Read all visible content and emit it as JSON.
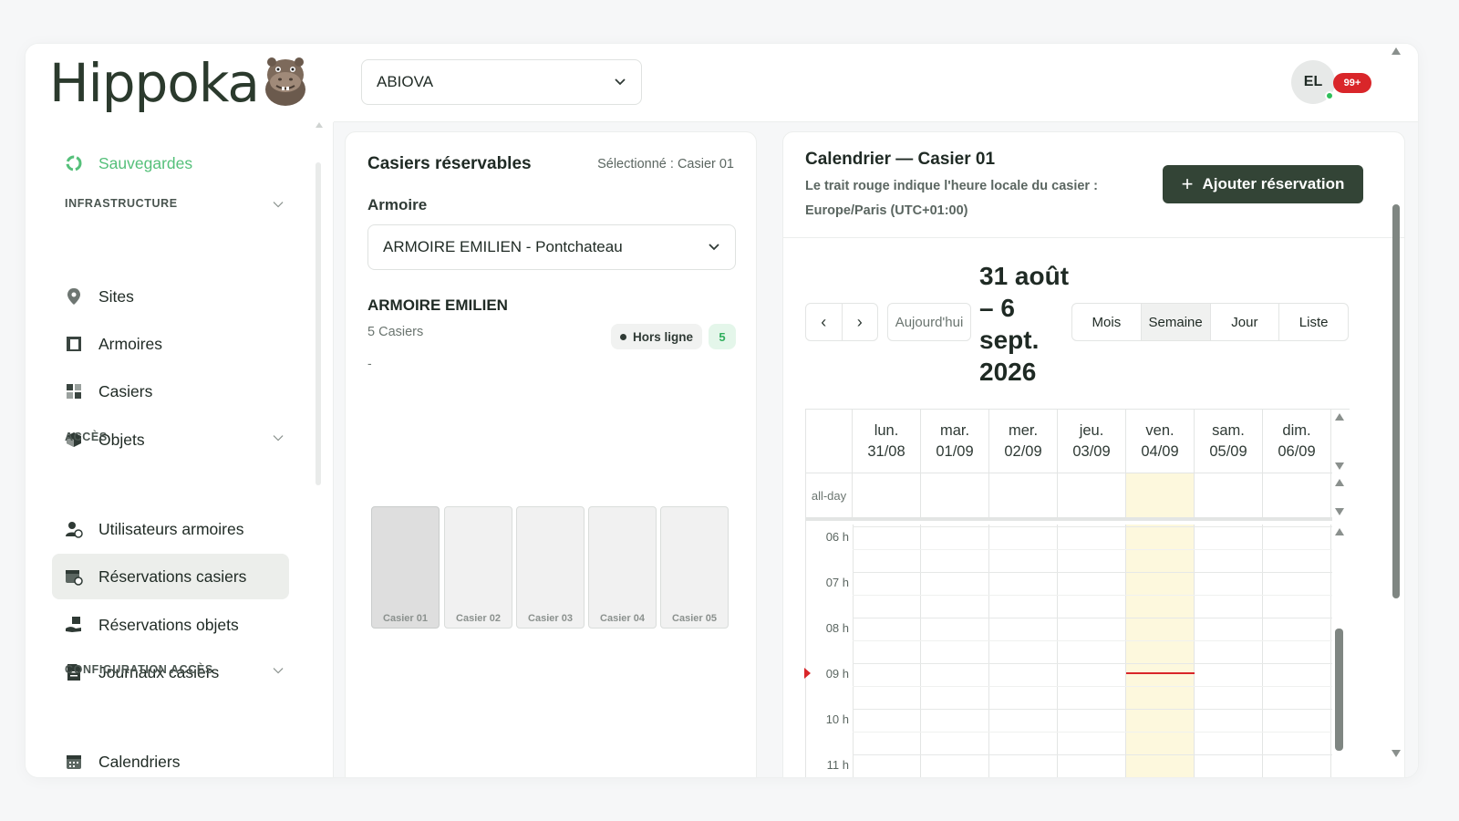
{
  "brand": {
    "name": "Hippoka"
  },
  "header": {
    "org_select_value": "ABIOVA",
    "user_initials": "EL",
    "notification_count": "99+"
  },
  "sidebar": {
    "top_item": {
      "label": "Sauvegardes",
      "icon": "backup-icon"
    },
    "groups": [
      {
        "title": "INFRASTRUCTURE",
        "items": [
          {
            "label": "Sites",
            "icon": "location-pin-icon"
          },
          {
            "label": "Armoires",
            "icon": "cabinet-icon"
          },
          {
            "label": "Casiers",
            "icon": "grid-icon"
          },
          {
            "label": "Objets",
            "icon": "cube-icon"
          }
        ]
      },
      {
        "title": "ACCÈS",
        "items": [
          {
            "label": "Utilisateurs armoires",
            "icon": "user-check-icon"
          },
          {
            "label": "Réservations casiers",
            "icon": "calendar-check-icon",
            "active": true
          },
          {
            "label": "Réservations objets",
            "icon": "hand-box-icon"
          },
          {
            "label": "Journaux casiers",
            "icon": "journal-icon"
          }
        ]
      },
      {
        "title": "CONFIGURATION ACCÈS",
        "items": [
          {
            "label": "Calendriers",
            "icon": "calendar-icon"
          }
        ]
      }
    ]
  },
  "lockers_panel": {
    "title": "Casiers réservables",
    "selected_text": "Sélectionné : Casier 01",
    "cabinet_label": "Armoire",
    "cabinet_select_value": "ARMOIRE EMILIEN - Pontchateau",
    "cabinet_name": "ARMOIRE EMILIEN",
    "cabinet_count": "5 Casiers",
    "cabinet_description": "-",
    "status": "Hors ligne",
    "count_badge": "5",
    "lockers": [
      {
        "label": "Casier 01",
        "selected": true
      },
      {
        "label": "Casier 02",
        "selected": false
      },
      {
        "label": "Casier 03",
        "selected": false
      },
      {
        "label": "Casier 04",
        "selected": false
      },
      {
        "label": "Casier 05",
        "selected": false
      }
    ]
  },
  "calendar": {
    "title": "Calendrier — Casier 01",
    "subtitle": "Le trait rouge indique l'heure locale du casier : Europe/Paris (UTC+01:00)",
    "add_button": "Ajouter réservation",
    "prev_label": "‹",
    "next_label": "›",
    "today_label": "Aujourd'hui",
    "range_label": "31 août – 6 sept. 2026",
    "views": [
      "Mois",
      "Semaine",
      "Jour",
      "Liste"
    ],
    "active_view": "Semaine",
    "days": [
      {
        "name": "lun.",
        "date": "31/08"
      },
      {
        "name": "mar.",
        "date": "01/09"
      },
      {
        "name": "mer.",
        "date": "02/09"
      },
      {
        "name": "jeu.",
        "date": "03/09"
      },
      {
        "name": "ven.",
        "date": "04/09",
        "today": true
      },
      {
        "name": "sam.",
        "date": "05/09"
      },
      {
        "name": "dim.",
        "date": "06/09"
      }
    ],
    "allday_label": "all-day",
    "hours": [
      "06 h",
      "07 h",
      "08 h",
      "09 h",
      "10 h",
      "11 h"
    ],
    "now_time_hours": 9.2,
    "colors": {
      "accent": "#334436",
      "today_bg": "#fdf8dd",
      "now_line": "#d9262a",
      "online_badge": "#2fae5c"
    }
  }
}
